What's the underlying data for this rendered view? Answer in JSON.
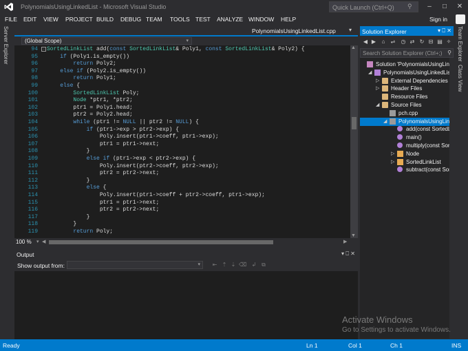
{
  "window": {
    "title": "PolynomialsUsingLinkedList - Microsoft Visual Studio",
    "quick_launch_placeholder": "Quick Launch (Ctrl+Q)",
    "controls": [
      "–",
      "□",
      "✕"
    ]
  },
  "menu": {
    "items": [
      "FILE",
      "EDIT",
      "VIEW",
      "PROJECT",
      "BUILD",
      "DEBUG",
      "TEAM",
      "TOOLS",
      "TEST",
      "ANALYZE",
      "WINDOW",
      "HELP"
    ],
    "sign_in": "Sign in"
  },
  "left_tabs": {
    "server_explorer": "Server Explorer"
  },
  "editor": {
    "tab": "PolynomialsUsingLinkedList.cpp",
    "scope": "(Global Scope)",
    "zoom": "100 %",
    "lines": [
      {
        "n": "94",
        "text": "SortedLinkList add(const SortedLinkList& Poly1, const SortedLinkList& Poly2) {"
      },
      {
        "n": "95",
        "text": "    if (Poly1.is_empty())"
      },
      {
        "n": "96",
        "text": "        return Poly2;"
      },
      {
        "n": "97",
        "text": "    else if (Poly2.is_empty())"
      },
      {
        "n": "98",
        "text": "        return Poly1;"
      },
      {
        "n": "99",
        "text": "    else {"
      },
      {
        "n": "100",
        "text": "        SortedLinkList Poly;"
      },
      {
        "n": "101",
        "text": "        Node *ptr1, *ptr2;"
      },
      {
        "n": "102",
        "text": "        ptr1 = Poly1.head;"
      },
      {
        "n": "103",
        "text": "        ptr2 = Poly2.head;"
      },
      {
        "n": "104",
        "text": "        while (ptr1 != NULL || ptr2 != NULL) {"
      },
      {
        "n": "105",
        "text": "            if (ptr1->exp > ptr2->exp) {"
      },
      {
        "n": "106",
        "text": "                Poly.insert(ptr1->coeff, ptr1->exp);"
      },
      {
        "n": "107",
        "text": "                ptr1 = ptr1->next;"
      },
      {
        "n": "108",
        "text": "            }"
      },
      {
        "n": "109",
        "text": "            else if (ptr1->exp < ptr2->exp) {"
      },
      {
        "n": "110",
        "text": "                Poly.insert(ptr2->coeff, ptr2->exp);"
      },
      {
        "n": "111",
        "text": "                ptr2 = ptr2->next;"
      },
      {
        "n": "112",
        "text": "            }"
      },
      {
        "n": "113",
        "text": "            else {"
      },
      {
        "n": "114",
        "text": "                Poly.insert(ptr1->coeff + ptr2->coeff, ptr1->exp);"
      },
      {
        "n": "115",
        "text": "                ptr1 = ptr1->next;"
      },
      {
        "n": "116",
        "text": "                ptr2 = ptr2->next;"
      },
      {
        "n": "117",
        "text": "            }"
      },
      {
        "n": "118",
        "text": "        }"
      },
      {
        "n": "119",
        "text": "        return Poly;"
      }
    ]
  },
  "output": {
    "title": "Output",
    "controls": "▾ ⎕ ✕",
    "show_output_from": "Show output from:"
  },
  "solution_explorer": {
    "title": "Solution Explorer",
    "controls": "▾ ⎕ ✕",
    "search_placeholder": "Search Solution Explorer (Ctrl+;)",
    "tree": [
      {
        "label": "Solution 'PolynomialsUsingLinkedList'",
        "depth": 0,
        "icon": "solution-icon",
        "arrow": ""
      },
      {
        "label": "PolynomialsUsingLinkedList",
        "depth": 1,
        "icon": "project-icon",
        "arrow": "◢"
      },
      {
        "label": "External Dependencies",
        "depth": 2,
        "icon": "folder-icon",
        "arrow": "▷"
      },
      {
        "label": "Header Files",
        "depth": 2,
        "icon": "folder-icon",
        "arrow": "▷"
      },
      {
        "label": "Resource Files",
        "depth": 2,
        "icon": "folder-icon",
        "arrow": ""
      },
      {
        "label": "Source Files",
        "depth": 2,
        "icon": "folder-icon",
        "arrow": "◢"
      },
      {
        "label": "pch.cpp",
        "depth": 3,
        "icon": "cpp-file-icon",
        "arrow": ""
      },
      {
        "label": "PolynomialsUsingLinkedList.cpp",
        "depth": 3,
        "icon": "cpp-file-icon",
        "arrow": "◢",
        "selected": true
      },
      {
        "label": "add(const SortedLinkList&",
        "depth": 4,
        "icon": "function-icon",
        "arrow": ""
      },
      {
        "label": "main()",
        "depth": 4,
        "icon": "function-icon",
        "arrow": ""
      },
      {
        "label": "multiply(const SortedLinkL",
        "depth": 4,
        "icon": "function-icon",
        "arrow": ""
      },
      {
        "label": "Node",
        "depth": 4,
        "icon": "class-icon",
        "arrow": "▷"
      },
      {
        "label": "SortedLinkList",
        "depth": 4,
        "icon": "class-icon",
        "arrow": "▷"
      },
      {
        "label": "subtract(const SortedLinkL",
        "depth": 4,
        "icon": "function-icon",
        "arrow": ""
      }
    ]
  },
  "right_tabs": [
    "Team Explorer",
    "Class View"
  ],
  "watermark": {
    "line1": "Activate Windows",
    "line2": "Go to Settings to activate Windows."
  },
  "status": {
    "ready": "Ready",
    "ln": "Ln 1",
    "col": "Col 1",
    "ch": "Ch 1",
    "ins": "INS"
  },
  "colors": {
    "accent": "#007acc",
    "background": "#2d2d30",
    "editor_bg": "#1e1e1e",
    "keyword": "#569cd6",
    "type": "#4ec9b0",
    "line_number": "#2b91af"
  }
}
